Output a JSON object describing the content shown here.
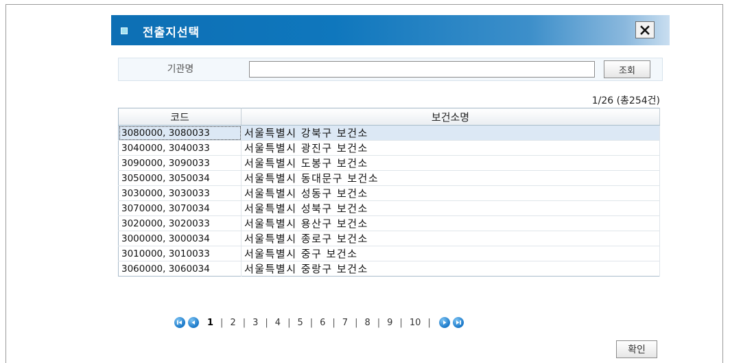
{
  "dialog": {
    "title": "전출지선택"
  },
  "search": {
    "label": "기관명",
    "value": "",
    "placeholder": "",
    "button_label": "조회"
  },
  "pagination_info": "1/26 (총254건)",
  "table": {
    "headers": [
      "코드",
      "보건소명"
    ],
    "rows": [
      {
        "code": "3080000, 3080033",
        "name": "서울특별시 강북구 보건소"
      },
      {
        "code": "3040000, 3040033",
        "name": "서울특별시 광진구 보건소"
      },
      {
        "code": "3090000, 3090033",
        "name": "서울특별시 도봉구 보건소"
      },
      {
        "code": "3050000, 3050034",
        "name": "서울특별시 동대문구 보건소"
      },
      {
        "code": "3030000, 3030033",
        "name": "서울특별시 성동구 보건소"
      },
      {
        "code": "3070000, 3070034",
        "name": "서울특별시 성북구 보건소"
      },
      {
        "code": "3020000, 3020033",
        "name": "서울특별시 용산구 보건소"
      },
      {
        "code": "3000000, 3000034",
        "name": "서울특별시 종로구 보건소"
      },
      {
        "code": "3010000, 3010033",
        "name": "서울특별시 중구 보건소"
      },
      {
        "code": "3060000, 3060034",
        "name": "서울특별시 중랑구 보건소"
      }
    ]
  },
  "pager": {
    "pages": [
      "1",
      "2",
      "3",
      "4",
      "5",
      "6",
      "7",
      "8",
      "9",
      "10"
    ],
    "current": "1",
    "icons": [
      "first-page-icon",
      "prev-page-icon",
      "next-page-icon",
      "last-page-icon"
    ]
  },
  "confirm_label": "확인",
  "colors": {
    "titlebar": "#0f77bd",
    "selected_row": "#dce8f5",
    "nav_icon": "#1a78c8"
  }
}
